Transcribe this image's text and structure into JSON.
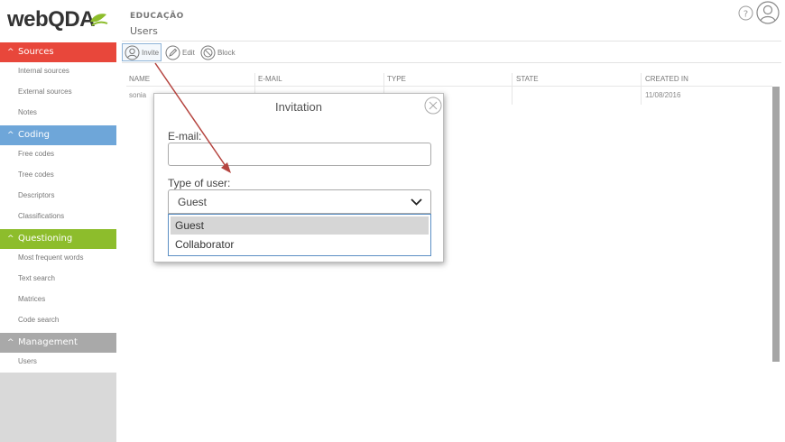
{
  "app": {
    "logo_text": "webQDA"
  },
  "sidebar": {
    "sections": [
      {
        "label": "Sources",
        "color": "#e8473b",
        "items": [
          "Internal sources",
          "External sources",
          "Notes"
        ]
      },
      {
        "label": "Coding",
        "color": "#6ea6d9",
        "items": [
          "Free codes",
          "Tree codes",
          "Descriptors",
          "Classifications"
        ]
      },
      {
        "label": "Questioning",
        "color": "#8dbd2c",
        "items": [
          "Most frequent words",
          "Text search",
          "Matrices",
          "Code search"
        ]
      },
      {
        "label": "Management",
        "color": "#a9a9a9",
        "items": [
          "Users"
        ]
      }
    ]
  },
  "header": {
    "project": "EDUCAÇÃO",
    "page_title": "Users"
  },
  "toolbar": {
    "invite_label": "Invite",
    "edit_label": "Edit",
    "block_label": "Block"
  },
  "table": {
    "columns": [
      "NAME",
      "E-MAIL",
      "TYPE",
      "STATE",
      "CREATED IN"
    ],
    "rows": [
      {
        "name": "sonia",
        "email": "",
        "type": "",
        "state": "",
        "created": "11/08/2016"
      }
    ]
  },
  "modal": {
    "title": "Invitation",
    "email_label": "E-mail:",
    "email_value": "",
    "type_label": "Type of user:",
    "type_selected": "Guest",
    "options": [
      "Guest",
      "Collaborator"
    ]
  },
  "colors": {
    "annotation_arrow": "#b5443f"
  }
}
